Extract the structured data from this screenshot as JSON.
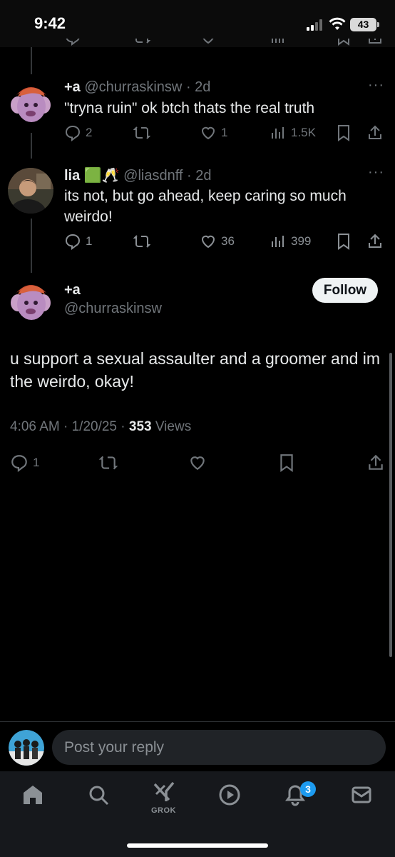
{
  "status_bar": {
    "time": "9:42",
    "battery": "43"
  },
  "tweets": [
    {
      "name": "+a",
      "handle": "@churraskinsw",
      "time": "2d",
      "text": "\"tryna ruin\" ok btch thats the real truth",
      "replies": "2",
      "reposts": "",
      "likes": "1",
      "views": "1.5K"
    },
    {
      "name": "lia 🟩🥂",
      "handle": "@liasdnff",
      "time": "2d",
      "text": "its not, but go ahead, keep caring so much weirdo!",
      "replies": "1",
      "reposts": "",
      "likes": "36",
      "views": "399"
    }
  ],
  "main_tweet": {
    "name": "+a",
    "handle": "@churraskinsw",
    "follow_label": "Follow",
    "text": "u support a sexual assaulter and a groomer and im the weirdo, okay!",
    "timestamp": "4:06 AM · 1/20/25 · ",
    "views_count": "353",
    "views_label": " Views",
    "replies": "1"
  },
  "reply": {
    "placeholder": "Post your reply"
  },
  "tabbar": {
    "grok_label": "GROK",
    "notifications_badge": "3"
  },
  "colors": {
    "accent": "#1d9bf0",
    "muted": "#71767b",
    "background": "#000000"
  }
}
